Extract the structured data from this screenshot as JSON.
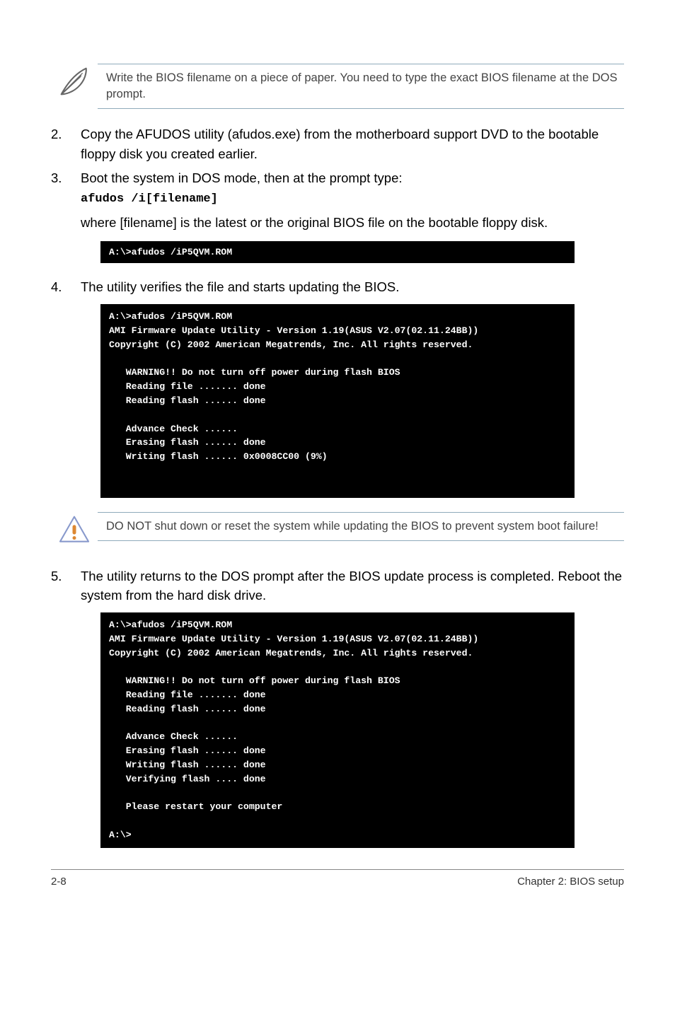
{
  "note1": "Write the BIOS filename on a piece of paper. You need to type the exact BIOS filename at the DOS prompt.",
  "step2": {
    "num": "2.",
    "text": "Copy the AFUDOS utility (afudos.exe) from the motherboard support DVD to the bootable floppy disk you created earlier."
  },
  "step3": {
    "num": "3.",
    "text": "Boot the system in DOS mode, then at the prompt type:",
    "cmd": "afudos /i[filename]"
  },
  "where_text": "where [filename] is the latest or the original BIOS file on the bootable floppy disk.",
  "terminal1": "A:\\>afudos /iP5QVM.ROM",
  "step4": {
    "num": "4.",
    "text": "The utility verifies the file and starts updating the BIOS."
  },
  "terminal2": "A:\\>afudos /iP5QVM.ROM\nAMI Firmware Update Utility - Version 1.19(ASUS V2.07(02.11.24BB))\nCopyright (C) 2002 American Megatrends, Inc. All rights reserved.\n\n   WARNING!! Do not turn off power during flash BIOS\n   Reading file ....... done\n   Reading flash ...... done\n\n   Advance Check ......\n   Erasing flash ...... done\n   Writing flash ...... 0x0008CC00 (9%)\n\n\n",
  "warning1": "DO NOT shut down or reset the system while updating the BIOS to prevent system boot failure!",
  "step5": {
    "num": "5.",
    "text": "The utility returns to the DOS prompt after the BIOS update process is completed. Reboot the system from the hard disk drive."
  },
  "terminal3": "A:\\>afudos /iP5QVM.ROM\nAMI Firmware Update Utility - Version 1.19(ASUS V2.07(02.11.24BB))\nCopyright (C) 2002 American Megatrends, Inc. All rights reserved.\n\n   WARNING!! Do not turn off power during flash BIOS\n   Reading file ....... done\n   Reading flash ...... done\n\n   Advance Check ......\n   Erasing flash ...... done\n   Writing flash ...... done\n   Verifying flash .... done\n\n   Please restart your computer\n\nA:\\>",
  "footer": {
    "left": "2-8",
    "right": "Chapter 2: BIOS setup"
  }
}
